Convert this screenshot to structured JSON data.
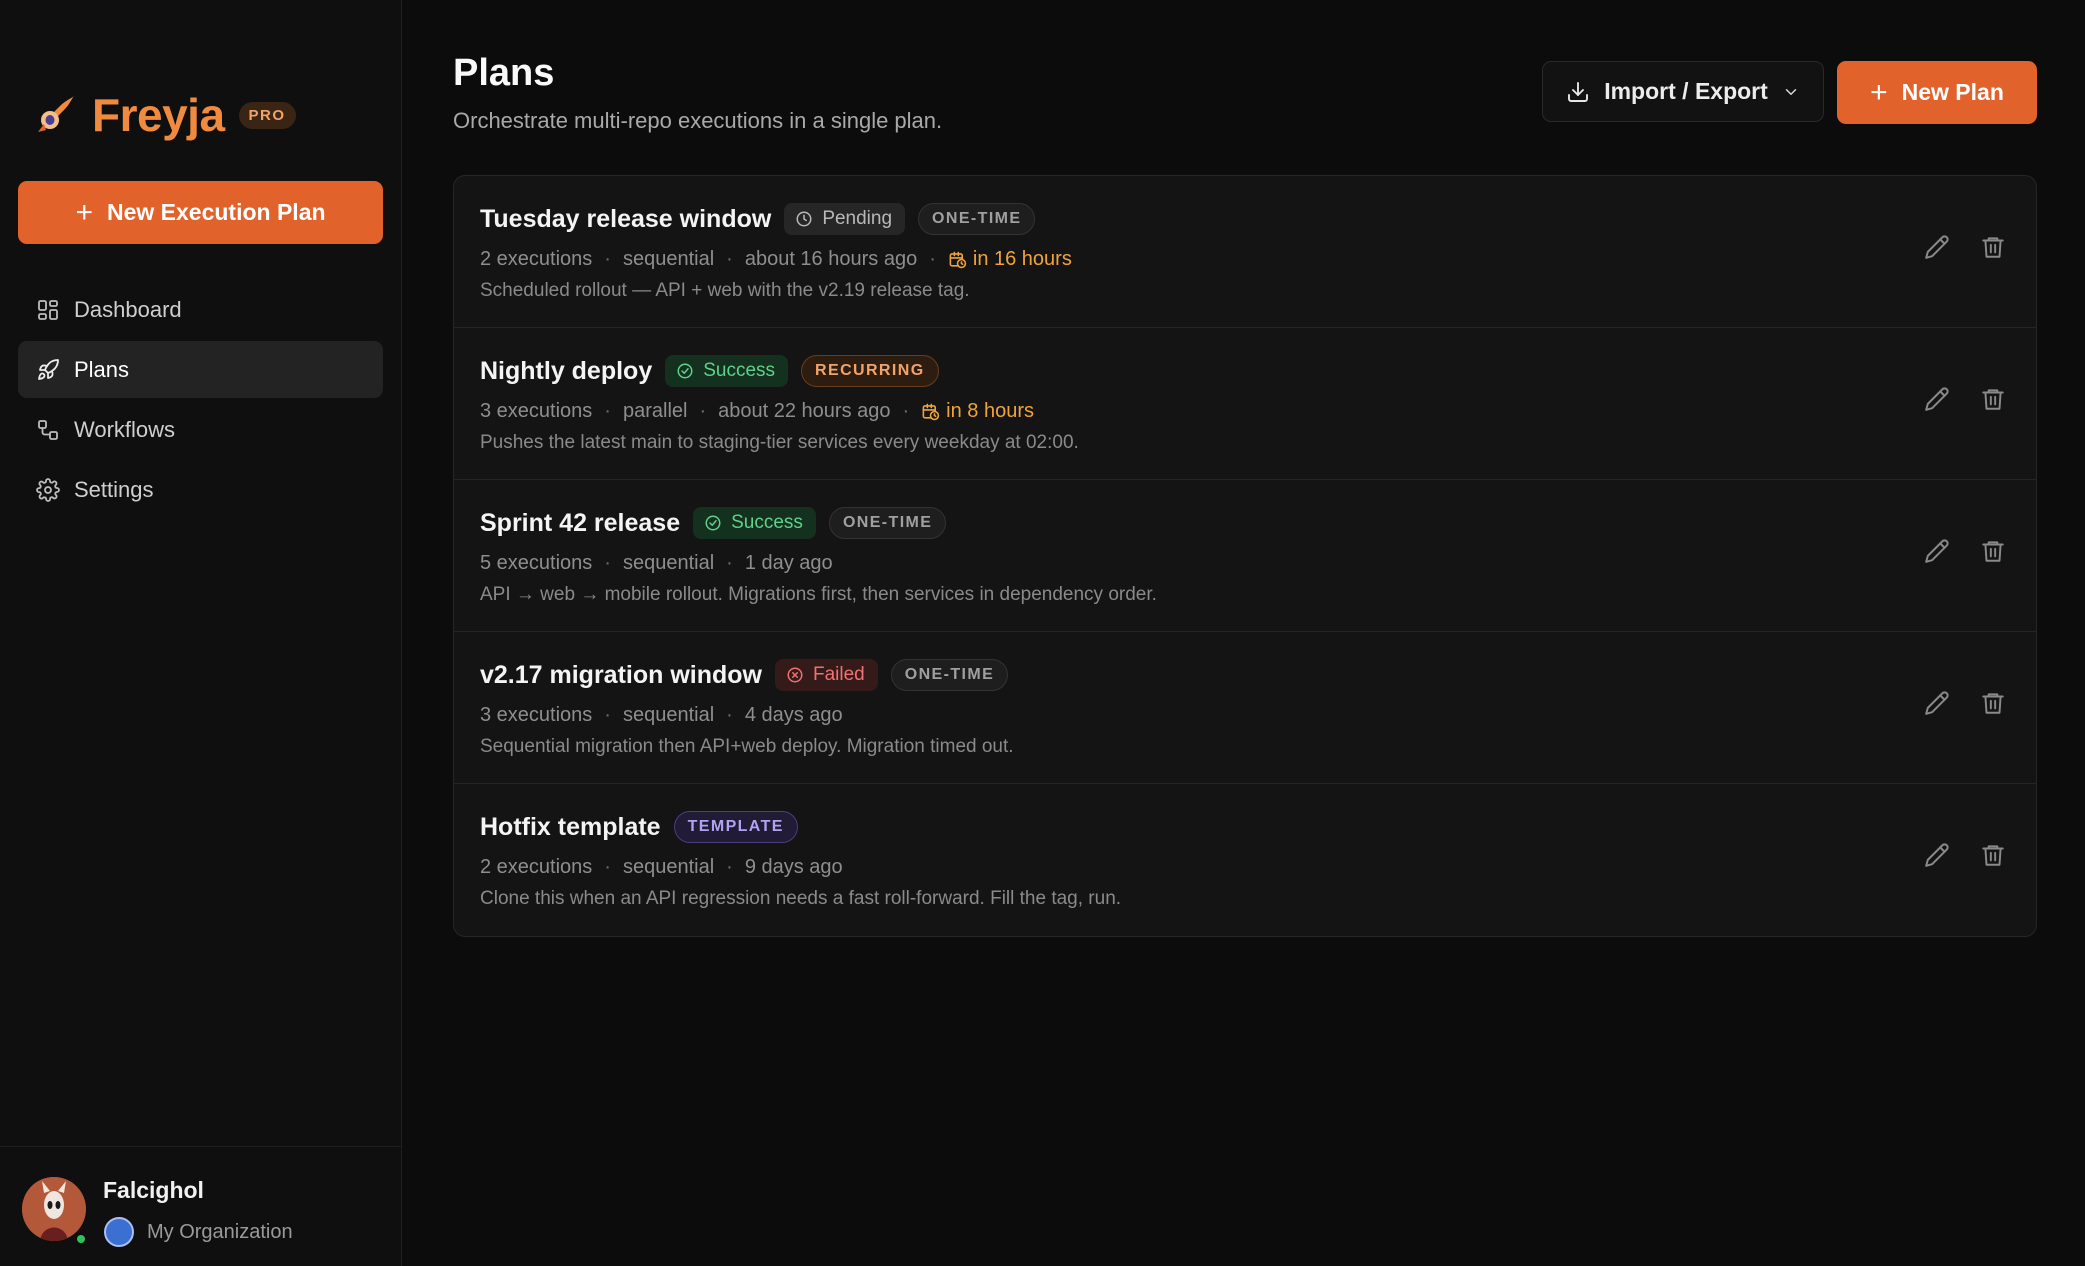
{
  "app": {
    "brand_name": "Freyja",
    "brand_badge": "PRO",
    "accent": "#e1622a"
  },
  "sidebar": {
    "new_plan_label": "New Execution Plan",
    "items": [
      {
        "label": "Dashboard",
        "icon": "dashboard-icon",
        "active": false
      },
      {
        "label": "Plans",
        "icon": "rocket-icon",
        "active": true
      },
      {
        "label": "Workflows",
        "icon": "workflow-icon",
        "active": false
      },
      {
        "label": "Settings",
        "icon": "gear-icon",
        "active": false
      }
    ],
    "user": {
      "name": "Falcighol",
      "org": "My Organization",
      "status_color": "#30c15a"
    }
  },
  "header": {
    "title": "Plans",
    "subtitle": "Orchestrate multi-repo executions in a single plan.",
    "import_export_label": "Import / Export",
    "new_plan_label": "New Plan"
  },
  "plans": [
    {
      "name": "Tuesday release window",
      "status": "Pending",
      "status_icon": "clock-icon",
      "tag": "ONE-TIME",
      "executions": "2 executions",
      "mode": "sequential",
      "updated": "about 16 hours ago",
      "schedule": "in 16 hours",
      "description": "Scheduled rollout — API + web with the v2.19 release tag."
    },
    {
      "name": "Nightly deploy",
      "status": "Success",
      "status_icon": "check-circle-icon",
      "tag": "RECURRING",
      "executions": "3 executions",
      "mode": "parallel",
      "updated": "about 22 hours ago",
      "schedule": "in 8 hours",
      "description": "Pushes the latest main to staging-tier services every weekday at 02:00."
    },
    {
      "name": "Sprint 42 release",
      "status": "Success",
      "status_icon": "check-circle-icon",
      "tag": "ONE-TIME",
      "executions": "5 executions",
      "mode": "sequential",
      "updated": "1 day ago",
      "description": "API → web → mobile rollout. Migrations first, then services in dependency order."
    },
    {
      "name": "v2.17 migration window",
      "status": "Failed",
      "status_icon": "x-circle-icon",
      "tag": "ONE-TIME",
      "executions": "3 executions",
      "mode": "sequential",
      "updated": "4 days ago",
      "description": "Sequential migration then API+web deploy. Migration timed out."
    },
    {
      "name": "Hotfix template",
      "tag": "TEMPLATE",
      "executions": "2 executions",
      "mode": "sequential",
      "updated": "9 days ago",
      "description": "Clone this when an API regression needs a fast roll-forward. Fill the tag, run."
    }
  ]
}
